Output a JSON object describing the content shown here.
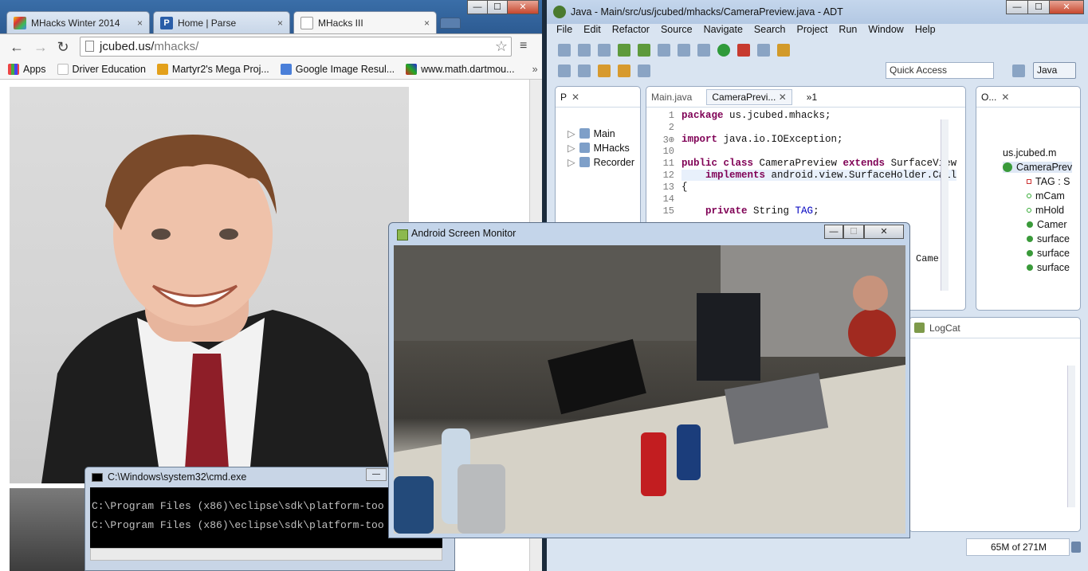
{
  "browser": {
    "tabs": [
      {
        "label": "MHacks Winter 2014",
        "close": "×"
      },
      {
        "label": "Home | Parse",
        "close": "×"
      },
      {
        "label": "MHacks III",
        "close": "×"
      }
    ],
    "url_host": "jcubed.us/",
    "url_path": "mhacks/",
    "bookmarks": [
      {
        "label": "Apps"
      },
      {
        "label": "Driver Education"
      },
      {
        "label": "Martyr2's Mega Proj..."
      },
      {
        "label": "Google Image Resul..."
      },
      {
        "label": "www.math.dartmou..."
      }
    ],
    "bookmarks_more": "»",
    "colors": {
      "tab_bar": "#2c5a91",
      "accent": "#3a6ea8"
    }
  },
  "cmd": {
    "title": "C:\\Windows\\system32\\cmd.exe",
    "lines": [
      "C:\\Program Files (x86)\\eclipse\\sdk\\platform-too",
      "C:\\Program Files (x86)\\eclipse\\sdk\\platform-too"
    ]
  },
  "adt": {
    "title": "Java - Main/src/us/jcubed/mhacks/CameraPreview.java - ADT",
    "menu": [
      "File",
      "Edit",
      "Refactor",
      "Source",
      "Navigate",
      "Search",
      "Project",
      "Run",
      "Window",
      "Help"
    ],
    "quick_access": "Quick Access",
    "perspective": "Java",
    "package_explorer": {
      "tab": "P",
      "items": [
        "Main",
        "MHacks",
        "Recorder"
      ]
    },
    "editor_tabs": [
      "Main.java",
      "CameraPrevi...",
      "»1"
    ],
    "code_lines": [
      {
        "n": "1",
        "text": "package us.jcubed.mhacks;"
      },
      {
        "n": "2",
        "text": ""
      },
      {
        "n": "3⊕",
        "text": "import java.io.IOException;"
      },
      {
        "n": "10",
        "text": ""
      },
      {
        "n": "11",
        "text": "public class CameraPreview extends SurfaceView"
      },
      {
        "n": "12",
        "text": "    implements android.view.SurfaceHolder.Call"
      },
      {
        "n": "13",
        "text": "{"
      },
      {
        "n": "14",
        "text": ""
      },
      {
        "n": "15",
        "text": "    private String TAG;"
      }
    ],
    "editor_partial": "Came",
    "outline": {
      "tab": "O...",
      "items": [
        "us.jcubed.m",
        "CameraPrev",
        "TAG : S",
        "mCam",
        "mHold",
        "Camer",
        "surface",
        "surface",
        "surface"
      ]
    },
    "logcat_tab": "LogCat",
    "memory": "65M of 271M"
  },
  "android_monitor": {
    "title": "Android Screen Monitor"
  },
  "window_controls": {
    "min": "—",
    "max": "☐",
    "close": "✕"
  }
}
